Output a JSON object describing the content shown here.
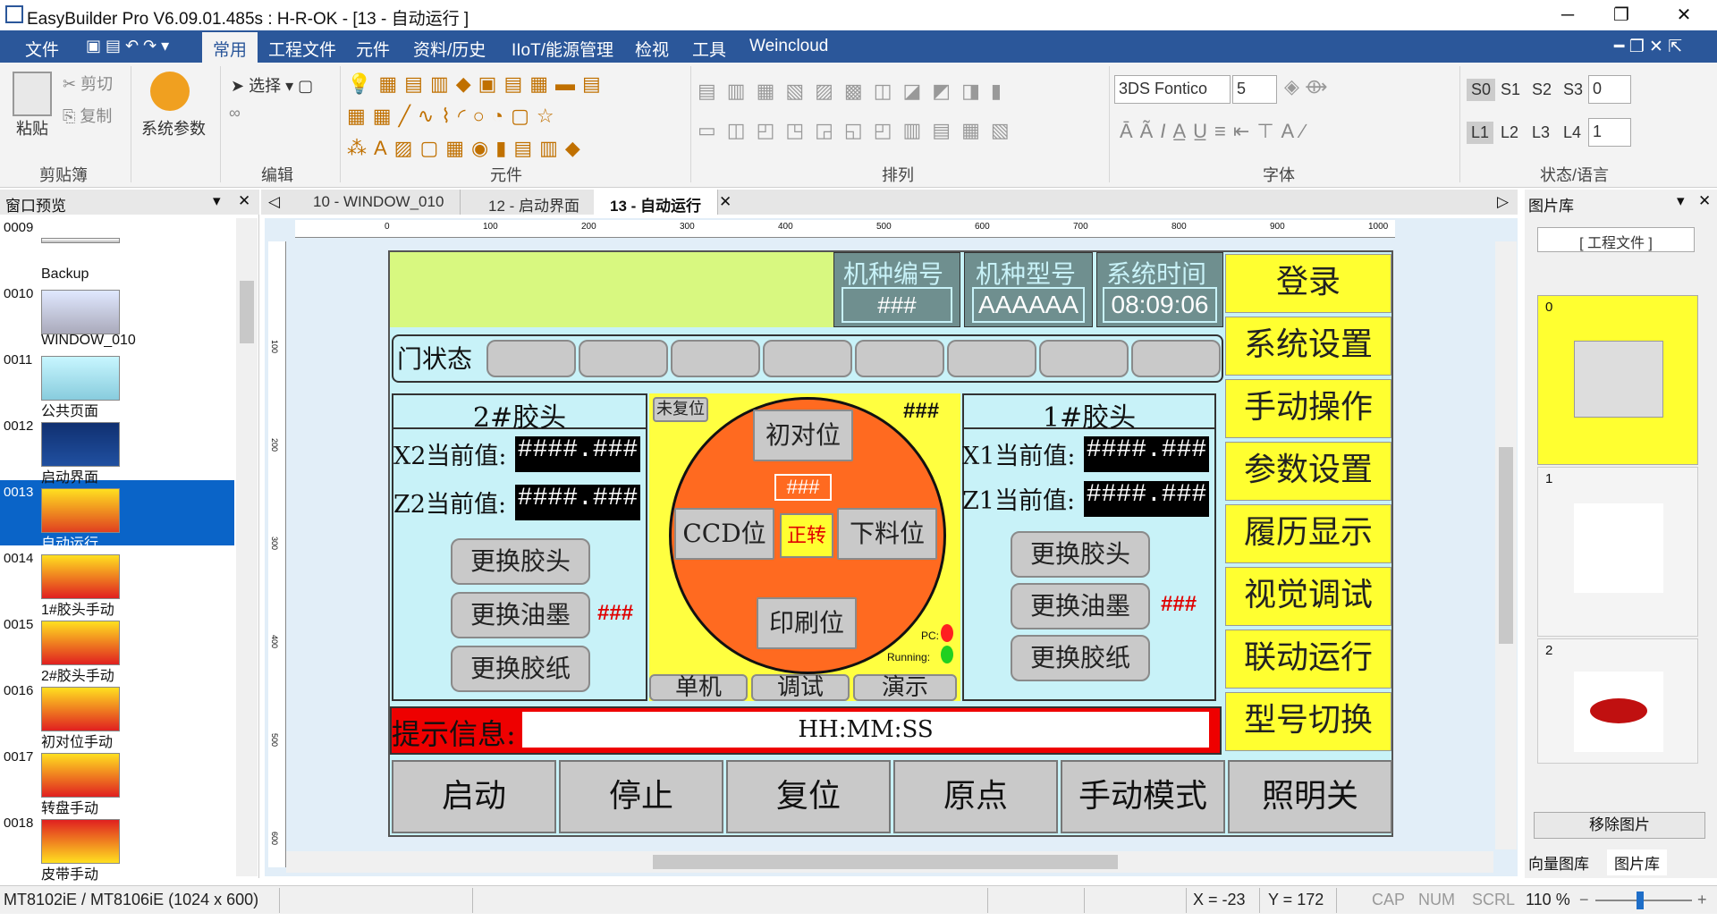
{
  "window": {
    "title": "EasyBuilder Pro V6.09.01.485s : H-R-OK - [13 - 自动运行 ]"
  },
  "menu": [
    "文件",
    "常用",
    "工程文件",
    "元件",
    "资料/历史",
    "IIoT/能源管理",
    "检视",
    "工具",
    "Weincloud"
  ],
  "ribbon": {
    "paste": "粘贴",
    "cut": "剪切",
    "copy": "复制",
    "sysparam": "系统参数",
    "select": "选择",
    "groups": {
      "clipboard": "剪贴簿",
      "edit": "编辑",
      "element": "元件",
      "arrange": "排列",
      "font": "字体",
      "state": "状态/语言"
    },
    "font_name": "3DS Fontico",
    "font_size": "5",
    "states": [
      "S0",
      "S1",
      "S2",
      "S3"
    ],
    "state_value": "0",
    "langs": [
      "L1",
      "L2",
      "L3",
      "L4"
    ],
    "lang_value": "1"
  },
  "left_panel": {
    "title": "窗口预览",
    "items": [
      {
        "num": "0009",
        "label": "Backup"
      },
      {
        "num": "0010",
        "label": "WINDOW_010"
      },
      {
        "num": "0011",
        "label": "公共页面"
      },
      {
        "num": "0012",
        "label": "启动界面"
      },
      {
        "num": "0013",
        "label": "自动运行"
      },
      {
        "num": "0014",
        "label": "1#胶头手动"
      },
      {
        "num": "0015",
        "label": "2#胶头手动"
      },
      {
        "num": "0016",
        "label": "初对位手动"
      },
      {
        "num": "0017",
        "label": "转盘手动"
      },
      {
        "num": "0018",
        "label": "皮带手动"
      }
    ]
  },
  "tabs": [
    "10 - WINDOW_010",
    "12 - 启动界面",
    "13 - 自动运行"
  ],
  "ruler_marks": [
    "0",
    "100",
    "200",
    "300",
    "400",
    "500",
    "600",
    "700",
    "800",
    "900",
    "1000"
  ],
  "vruler_marks": [
    "100",
    "200",
    "300",
    "400",
    "500",
    "600"
  ],
  "hmi": {
    "header": {
      "model_no_label": "机种编号",
      "model_no": "###",
      "model_type_label": "机种型号",
      "model_type": "AAAAAA",
      "time_label": "系统时间",
      "time": "08:09:06"
    },
    "door_label": "门状态",
    "left_head": {
      "title": "2#胶头",
      "x_label": "X2当前值:",
      "x_val": "####.###",
      "z_label": "Z2当前值:",
      "z_val": "####.###",
      "btn1": "更换胶头",
      "btn2": "更换油墨",
      "btn3": "更换胶纸",
      "hash": "###"
    },
    "right_head": {
      "title": "1#胶头",
      "x_label": "X1当前值:",
      "x_val": "####.###",
      "z_label": "Z1当前值:",
      "z_val": "####.###",
      "btn1": "更换胶头",
      "btn2": "更换油墨",
      "btn3": "更换胶纸",
      "hash": "###"
    },
    "center": {
      "unreset": "未复位",
      "hash_top": "###",
      "pos1": "初对位",
      "ccd": "CCD位",
      "hash_mid": "###",
      "fwd": "正转",
      "unload": "下料位",
      "print": "印刷位",
      "pc": "PC:",
      "running": "Running:",
      "mode1": "单机",
      "mode2": "调试",
      "mode3": "演示"
    },
    "msg": {
      "label": "提示信息:",
      "value": "HH:MM:SS"
    },
    "side": [
      "登录",
      "系统设置",
      "手动操作",
      "参数设置",
      "履历显示",
      "视觉调试",
      "联动运行",
      "型号切换"
    ],
    "bottom": [
      "启动",
      "停止",
      "复位",
      "原点",
      "手动模式",
      "照明关"
    ]
  },
  "right_panel": {
    "title": "图片库",
    "combo": "[ 工程文件 ]",
    "items": [
      "0",
      "1",
      "2"
    ],
    "remove_btn": "移除图片",
    "tab1": "向量图库",
    "tab2": "图片库"
  },
  "status": {
    "model": "MT8102iE / MT8106iE (1024 x 600)",
    "x": "X = -23",
    "y": "Y = 172",
    "cap": "CAP",
    "num": "NUM",
    "scrl": "SCRL",
    "zoom": "110 %"
  }
}
